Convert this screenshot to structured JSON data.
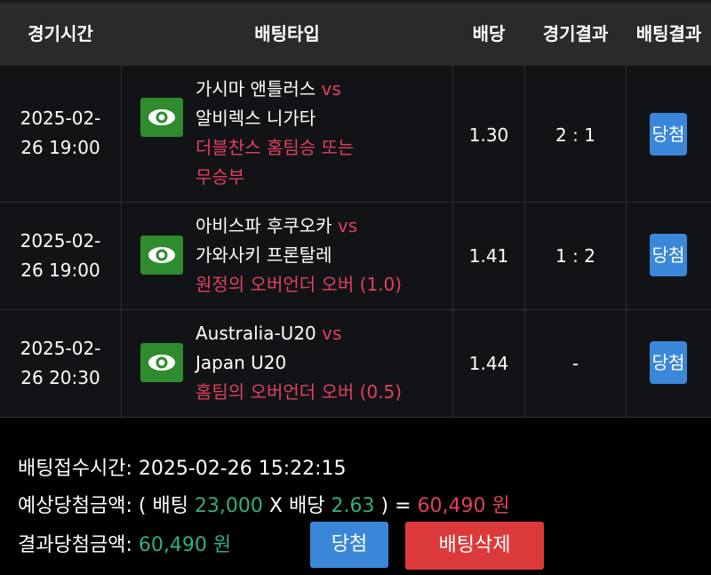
{
  "header": {
    "col_time": "경기시간",
    "col_bettype": "배팅타입",
    "col_odds": "배당",
    "col_game_result": "경기결과",
    "col_bet_result": "배팅결과"
  },
  "rows": [
    {
      "time_line1": "2025-02-",
      "time_line2": "26 19:00",
      "team_home": "가시마 앤틀러스",
      "vs": "vs",
      "team_away": "알비렉스 니가타",
      "pick_line1": "더블찬스 홈팀승 또는",
      "pick_line2": "무승부",
      "odds": "1.30",
      "game_result": "2 : 1",
      "bet_result": "당첨"
    },
    {
      "time_line1": "2025-02-",
      "time_line2": "26 19:00",
      "team_home": "아비스파 후쿠오카",
      "vs": "vs",
      "team_away": "가와사키 프론탈레",
      "pick_line1": "원정의 오버언더 오버 (1.0)",
      "odds": "1.41",
      "game_result": "1 : 2",
      "bet_result": "당첨"
    },
    {
      "time_line1": "2025-02-",
      "time_line2": "26 20:30",
      "team_home": "Australia-U20",
      "vs": "vs",
      "team_away": "Japan U20",
      "pick_line1": "홈팀의 오버언더 오버 (0.5)",
      "odds": "1.44",
      "game_result": "-",
      "bet_result": "당첨"
    }
  ],
  "footer": {
    "received_label": "배팅접수시간:",
    "received_time": "2025-02-26 15:22:15",
    "expected_label": "예상당첨금액:",
    "open_paren": "(",
    "bet_label": "배팅",
    "bet_amount": "23,000",
    "times": "X",
    "odds_label": "배당",
    "total_odds": "2.63",
    "close_paren": ")",
    "equals": "=",
    "expected_amount": "60,490 원",
    "result_label": "결과당첨금액:",
    "result_amount": "60,490 원",
    "win_button": "당첨",
    "delete_button": "배팅삭제"
  },
  "icons": {
    "view": "eye-icon"
  },
  "colors": {
    "accent_red": "#e0405f",
    "accent_green": "#2fb07c",
    "badge_blue": "#3a87d9",
    "delete_red": "#dc3a3a",
    "eye_green": "#2e8b2e"
  }
}
